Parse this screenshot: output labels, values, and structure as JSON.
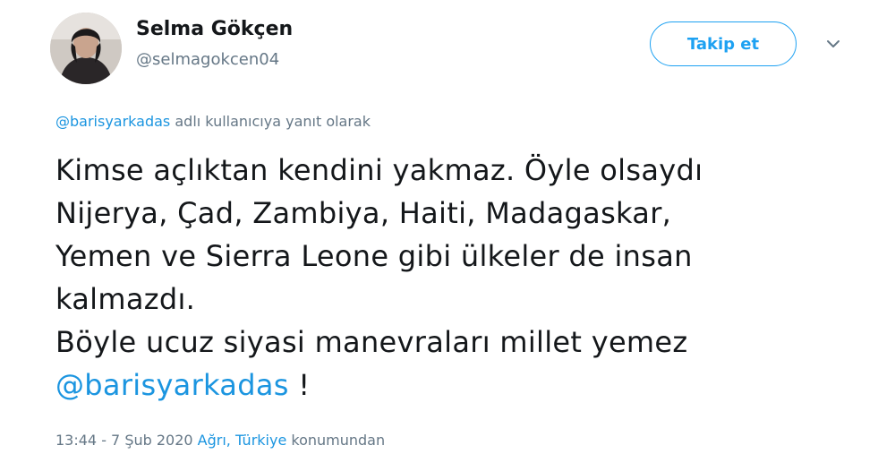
{
  "user": {
    "name": "Selma Gökçen",
    "handle": "@selmagokcen04"
  },
  "follow_button": {
    "label": "Takip et"
  },
  "menu": {
    "icon": "chevron-down-icon"
  },
  "reply_to": {
    "mention": "@barisyarkadas",
    "suffix": "adlı kullanıcıya yanıt olarak"
  },
  "tweet": {
    "lines": [
      "Kimse açlıktan kendini yakmaz. Öyle olsaydı",
      "Nijerya, Çad, Zambiya, Haiti, Madagaskar,",
      "Yemen ve Sierra Leone gibi ülkeler de insan",
      "kalmazdı.",
      "Böyle ucuz siyasi manevraları millet yemez"
    ],
    "mention": "@barisyarkadas",
    "ending": " !"
  },
  "meta": {
    "time": "13:44 - 7 Şub 2020",
    "location": "Ağrı, Türkiye",
    "suffix": "konumundan"
  },
  "colors": {
    "accent": "#1da1f2",
    "link": "#1b95e0",
    "secondary_text": "#657786",
    "primary_text": "#14171a"
  }
}
